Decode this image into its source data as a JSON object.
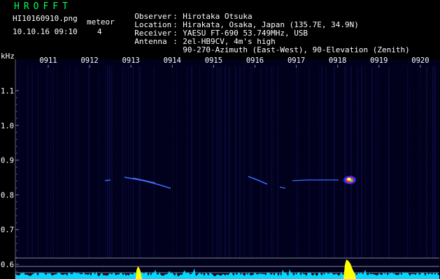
{
  "header": {
    "app_title": "HROFFT",
    "file_name": "HI10160910.png",
    "meteor_label": "meteor",
    "meteor_count": "4",
    "timestamp": "10.10.16 09:10"
  },
  "station_info": [
    {
      "key": "Observer",
      "value": "Hirotaka Otsuka"
    },
    {
      "key": "Location",
      "value": "Hirakata, Osaka, Japan (135.7E, 34.9N)"
    },
    {
      "key": "Receiver",
      "value": "YAESU FT-690 53.749MHz, USB"
    },
    {
      "key": "Antenna",
      "value": "2el-HB9CV, 4m's high"
    },
    {
      "key": "",
      "value": "90-270-Azimuth (East-West), 90-Elevation (Zenith)"
    }
  ],
  "spectrogram": {
    "y_unit_label": "kHz",
    "time_ticks": [
      "0911",
      "0912",
      "0913",
      "0914",
      "0915",
      "0916",
      "0917",
      "0918",
      "0919",
      "0920"
    ],
    "freq_ticks": [
      "1.1",
      "1.0",
      "0.9",
      "0.8",
      "0.7",
      "0.6"
    ],
    "colors": {
      "background": "#000022",
      "tick_text": "#ffffff",
      "title_green": "#00ff55",
      "noise_cyan": "#00e5ff",
      "signal_yellow": "#ffff00",
      "streak_blue": "#3a6cff"
    }
  }
}
